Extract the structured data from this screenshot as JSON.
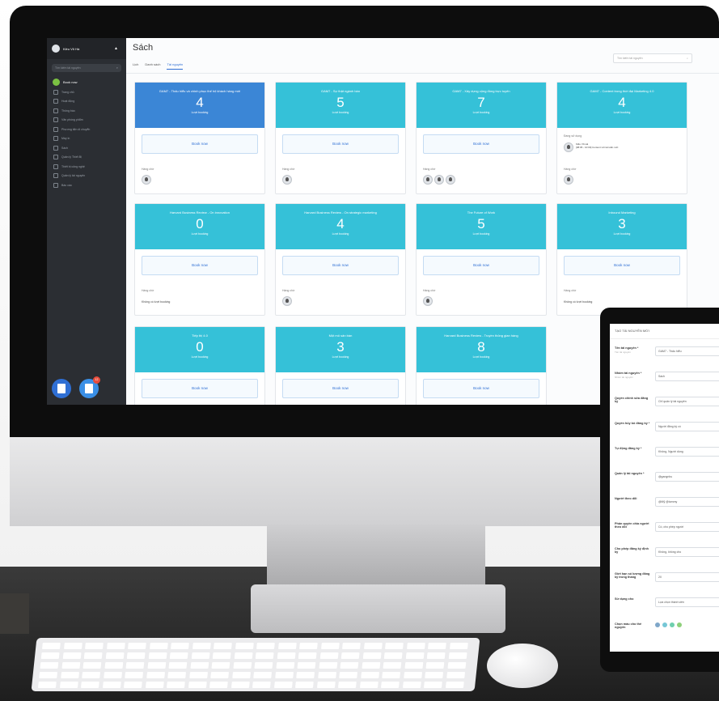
{
  "sidebar": {
    "user_name": "Kiều Võ Hà",
    "search_placeholder": "Tìm kiếm tài nguyên",
    "book_now_label": "Book now",
    "items": [
      {
        "label": "Trang chủ"
      },
      {
        "label": "Hoạt động"
      },
      {
        "label": "Thông báo"
      },
      {
        "label": "Văn phòng phẩm"
      },
      {
        "label": "Phương tiện di chuyển"
      },
      {
        "label": "Máy in"
      },
      {
        "label": "Sách"
      },
      {
        "label": "Quản lý Thiết Bị"
      },
      {
        "label": "Thiết bị công nghệ"
      },
      {
        "label": "Quản lý tài nguyên"
      },
      {
        "label": "Báo cáo"
      }
    ],
    "chat_badge": "12"
  },
  "main": {
    "title": "Sách",
    "tabs": [
      "Lịch",
      "Danh sách",
      "Tài nguyên"
    ],
    "active_tab": 2,
    "search_placeholder": "Tìm kiếm tài nguyên"
  },
  "cards": [
    {
      "name": "GAM7 - Thấu hiểu và chinh phục thế hệ khách hàng mới",
      "count": "4",
      "count_label": "Lượt booking",
      "button": "Book now",
      "queue_label": "Hàng chờ",
      "queue_avatars": 1,
      "selected": true
    },
    {
      "name": "GAM7 - Sự thật ngành bán",
      "count": "5",
      "count_label": "Lượt booking",
      "button": "Book now",
      "queue_label": "Hàng chờ",
      "queue_avatars": 1
    },
    {
      "name": "GAM7 - Xây dựng cộng đồng trực tuyến",
      "count": "7",
      "count_label": "Lượt booking",
      "button": "Book now",
      "queue_label": "Hàng chờ",
      "queue_avatars": 3
    },
    {
      "name": "GAM7 - Content trong thời đại Marketing 4.0",
      "count": "4",
      "count_label": "Lượt booking",
      "using_label": "Đang sử dụng",
      "using_user": "Kiều Võ Hà",
      "using_time": "[08:05 - 10:00] Content với tài tuần mới",
      "queue_label": "Hàng chờ",
      "queue_avatars": 1
    },
    {
      "name": "Harvard Business Review - On innovation",
      "count": "0",
      "count_label": "Lượt booking",
      "button": "Book now",
      "queue_label": "Hàng chờ",
      "queue_text": "Không có lượt booking"
    },
    {
      "name": "Harvard Business Review - On strategic marketing",
      "count": "4",
      "count_label": "Lượt booking",
      "button": "Book now",
      "queue_label": "Hàng chờ",
      "queue_avatars": 1
    },
    {
      "name": "The Future of Work",
      "count": "5",
      "count_label": "Lượt booking",
      "button": "Book now",
      "queue_label": "Hàng chờ",
      "queue_avatars": 1
    },
    {
      "name": "Inbound Marketing",
      "count": "3",
      "count_label": "Lượt booking",
      "button": "Book now",
      "queue_label": "Hàng chờ",
      "queue_text": "Không có lượt booking"
    },
    {
      "name": "Tiếp thị 4.0",
      "count": "0",
      "count_label": "Lượt booking",
      "button": "Book now"
    },
    {
      "name": "Một mô sản bàn",
      "count": "3",
      "count_label": "Lượt booking",
      "button": "Book now"
    },
    {
      "name": "Harvard Business Review - Truyền thông gian hàng",
      "count": "8",
      "count_label": "Lượt booking",
      "button": "Book now"
    }
  ],
  "tablet": {
    "header": "TẠO TÀI NGUYÊN MỚI",
    "fields": [
      {
        "label": "Tên tài nguyên *",
        "hint": "Tên tài nguyên",
        "value": "GAM7 - Thấu hiểu"
      },
      {
        "label": "Nhóm tài nguyên *",
        "hint": "Nhóm tài nguyên",
        "value": "Sách"
      },
      {
        "label": "Quyền chỉnh sửa đăng ký",
        "hint": "",
        "value": "Chỉ quản lý tài nguyên"
      },
      {
        "label": "Quyền hủy bỏ đăng ký *",
        "hint": "",
        "value": "Người đăng ký có"
      },
      {
        "label": "Tự động đăng ký *",
        "hint": "",
        "value": "Không, Người dùng"
      },
      {
        "label": "Quản lý tài nguyên *",
        "hint": "",
        "value": "@gangnhu"
      },
      {
        "label": "Người theo dõi",
        "hint": "",
        "value": "@Mỹ @tommy"
      },
      {
        "label": "Phân quyền chia người theo dõi",
        "hint": "",
        "value": "Có, cho phép người"
      },
      {
        "label": "Cho phép đăng ký định kỳ",
        "hint": "",
        "value": "Không, không cho"
      },
      {
        "label": "Giới hạn số lượng đăng ký trong tháng",
        "hint": "",
        "value": "20"
      },
      {
        "label": "Sử dụng cho",
        "hint": "",
        "value": "Lựa chọn thành viên"
      },
      {
        "label": "Chọn màu cho thẻ nguyên",
        "hint": ""
      }
    ],
    "color_dots": [
      "#7fa7c9",
      "#76c7d6",
      "#6fcfae",
      "#8ed07a"
    ]
  }
}
